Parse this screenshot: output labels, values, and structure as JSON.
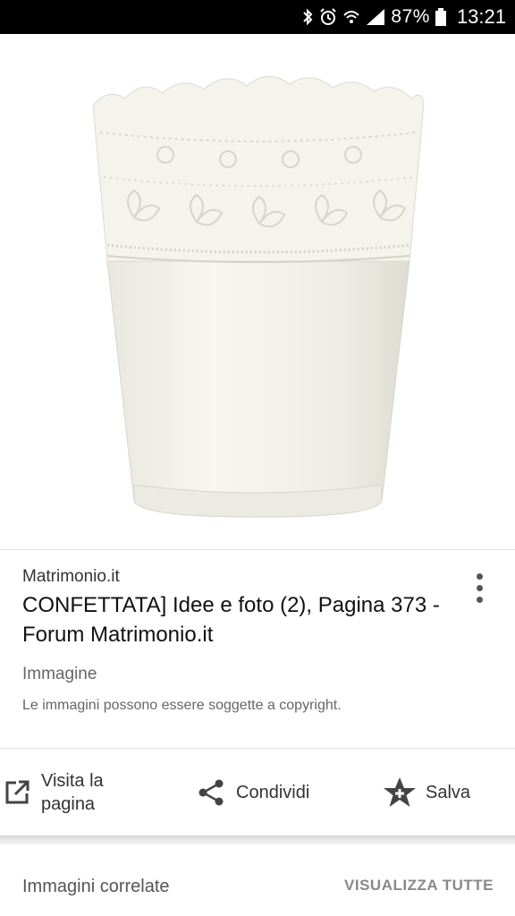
{
  "status_bar": {
    "battery_percent": "87%",
    "time": "13:21",
    "icons": [
      "bluetooth-icon",
      "alarm-icon",
      "wifi-icon",
      "signal-icon",
      "battery-icon"
    ]
  },
  "image": {
    "subject": "lace-pot-icon"
  },
  "result": {
    "source": "Matrimonio.it",
    "title": "CONFETTATA] Idee e foto (2), Pagina 373 - Forum Matrimonio.it",
    "type": "Immagine",
    "copyright": "Le immagini possono essere soggette a copyright."
  },
  "actions": {
    "visit_line1": "Visita la",
    "visit_line2": "pagina",
    "share": "Condividi",
    "save": "Salva"
  },
  "related": {
    "title": "Immagini correlate",
    "view_all": "VISUALIZZA TUTTE"
  }
}
